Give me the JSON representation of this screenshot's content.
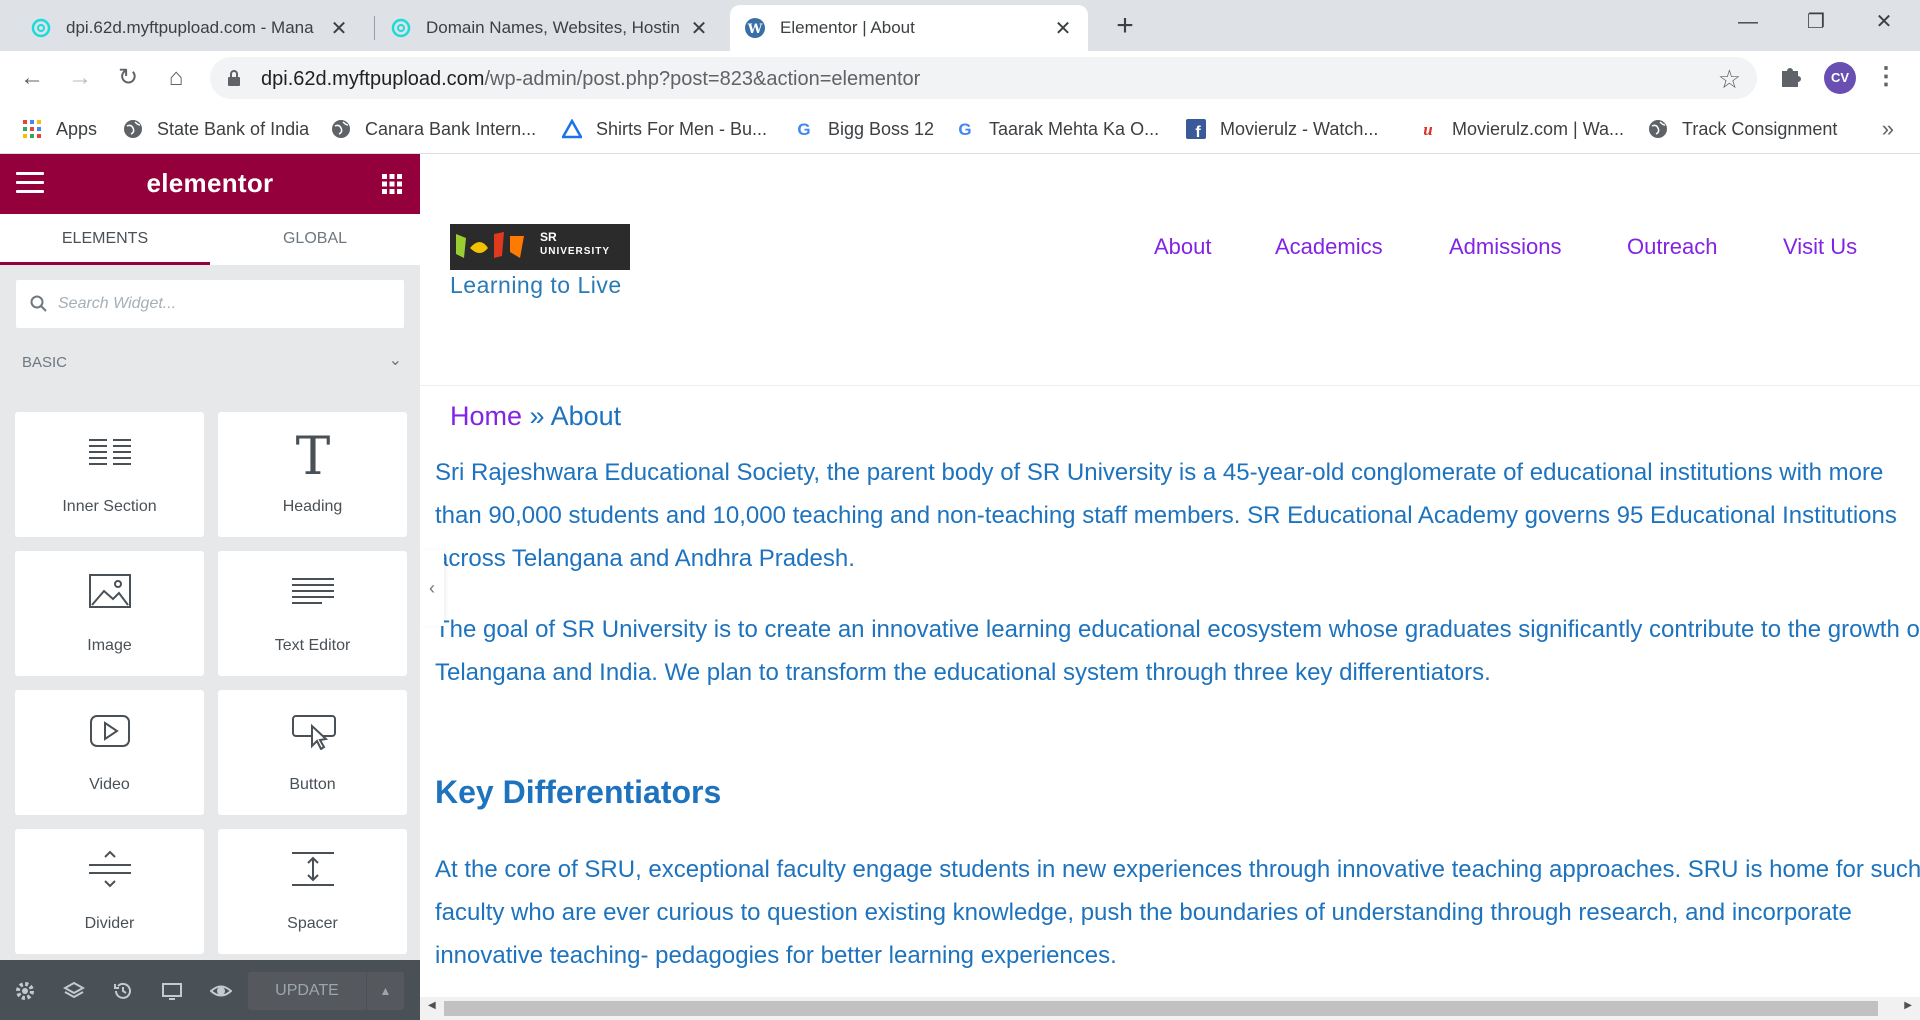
{
  "browser": {
    "tabs": [
      {
        "title": "dpi.62d.myftpupload.com - Mana",
        "icon": "godaddy-icon"
      },
      {
        "title": "Domain Names, Websites, Hostin",
        "icon": "godaddy-icon"
      },
      {
        "title": "Elementor | About",
        "icon": "wordpress-icon"
      }
    ],
    "url_host": "dpi.62d.myftpupload.com",
    "url_path": "/wp-admin/post.php?post=823&action=elementor",
    "profile_initials": "CV",
    "bookmarks": [
      {
        "label": "Apps",
        "icon": "apps-grid-icon"
      },
      {
        "label": "State Bank of India",
        "icon": "globe-icon"
      },
      {
        "label": "Canara Bank Intern...",
        "icon": "globe-icon"
      },
      {
        "label": "Shirts For Men - Bu...",
        "icon": "triangle-logo-icon"
      },
      {
        "label": "Bigg Boss 12",
        "icon": "google-icon"
      },
      {
        "label": "Taarak Mehta Ka O...",
        "icon": "google-icon"
      },
      {
        "label": "Movierulz - Watch...",
        "icon": "facebook-icon"
      },
      {
        "label": "Movierulz.com | Wa...",
        "icon": "u-logo-icon"
      },
      {
        "label": "Track Consignment",
        "icon": "globe-icon"
      }
    ]
  },
  "panel": {
    "brand": "elementor",
    "tabs": [
      "ELEMENTS",
      "GLOBAL"
    ],
    "search_placeholder": "Search Widget...",
    "category": "BASIC",
    "widgets": [
      "Inner Section",
      "Heading",
      "Image",
      "Text Editor",
      "Video",
      "Button",
      "Divider",
      "Spacer"
    ],
    "update_label": "UPDATE",
    "accent_color": "#93003c"
  },
  "page": {
    "logo_text_1": "SR",
    "logo_text_2": "UNIVERSITY",
    "tagline": "Learning to Live",
    "nav": [
      "About",
      "Academics",
      "Admissions",
      "Outreach",
      "Visit Us"
    ],
    "breadcrumb_home": "Home",
    "breadcrumb_sep": "»",
    "breadcrumb_current": "About",
    "para1": "Sri Rajeshwara Educational Society, the parent body of SR University is a 45-year-old conglomerate of educational institutions with more than 90,000 students and 10,000 teaching and non-teaching staff members. SR Educational Academy governs 95 Educational Institutions across Telangana and Andhra Pradesh.",
    "para2": "The goal of SR University is to create an innovative learning educational ecosystem whose graduates significantly contribute to the growth of Telangana and India. We plan to transform the educational system through three key differentiators.",
    "heading": "Key Differentiators",
    "para3": "At the core of SRU, exceptional faculty engage students in new experiences through innovative teaching approaches. SRU is home for such faculty who are ever curious to question existing knowledge, push the boundaries of understanding through research, and incorporate innovative teaching- pedagogies for better learning experiences."
  }
}
